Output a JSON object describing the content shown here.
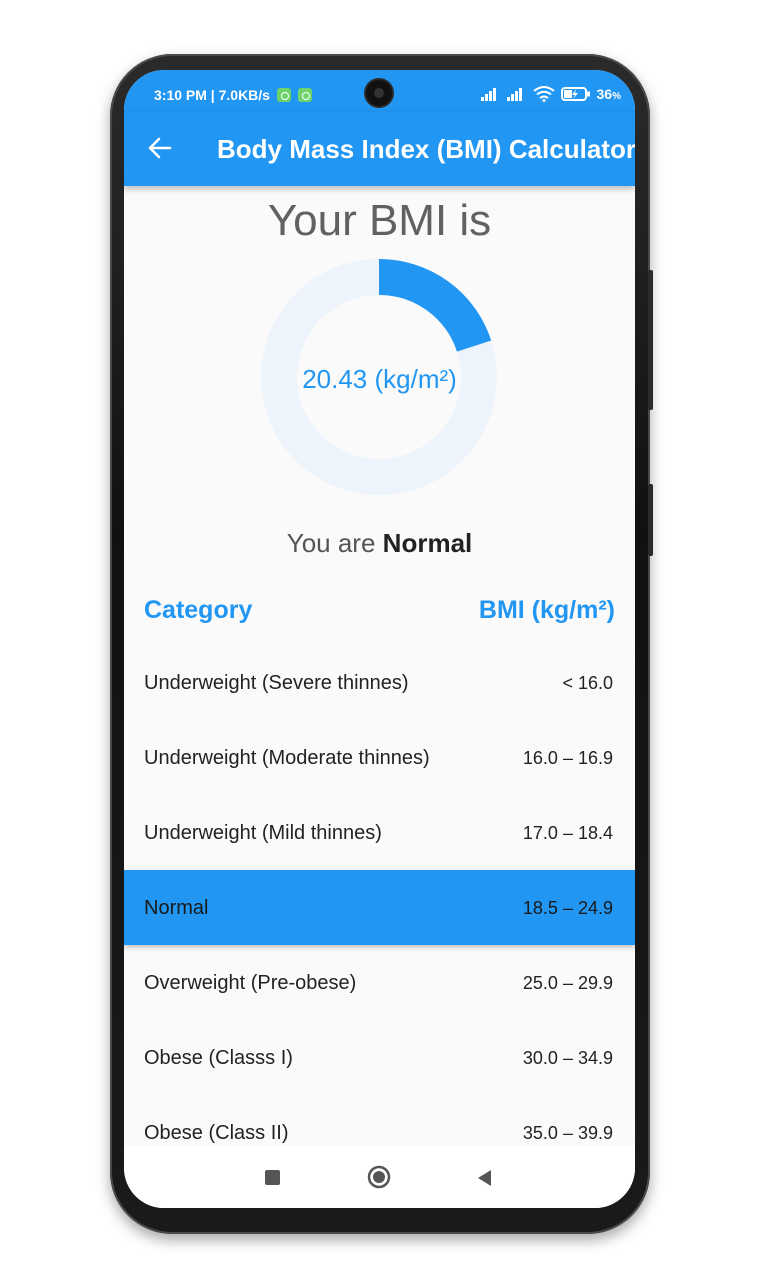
{
  "statusbar": {
    "time_info": "3:10 PM | 7.0KB/s",
    "battery": "36"
  },
  "appbar": {
    "title": "Body Mass Index (BMI) Calculator"
  },
  "result": {
    "heading": "Your BMI is",
    "value_text": "20.43 (kg/m²)",
    "gauge_fraction": 0.2,
    "prefix": "You are",
    "category": "Normal"
  },
  "table": {
    "header_category": "Category",
    "header_bmi": "BMI (kg/m²)",
    "rows": [
      {
        "category": "Underweight (Severe thinnes)",
        "range": "< 16.0"
      },
      {
        "category": "Underweight (Moderate thinnes)",
        "range": "16.0 – 16.9"
      },
      {
        "category": "Underweight (Mild thinnes)",
        "range": "17.0 – 18.4"
      },
      {
        "category": "Normal",
        "range": "18.5 – 24.9"
      },
      {
        "category": "Overweight (Pre-obese)",
        "range": "25.0 – 29.9"
      },
      {
        "category": "Obese (Classs I)",
        "range": "30.0 – 34.9"
      },
      {
        "category": "Obese (Class II)",
        "range": "35.0 – 39.9"
      }
    ]
  },
  "colors": {
    "accent": "#2196f3",
    "gauge_track": "#eef4fb"
  },
  "icons": {
    "back": "arrow-left-icon",
    "recents": "square-icon",
    "home": "circle-icon",
    "nav_back": "triangle-back-icon"
  }
}
